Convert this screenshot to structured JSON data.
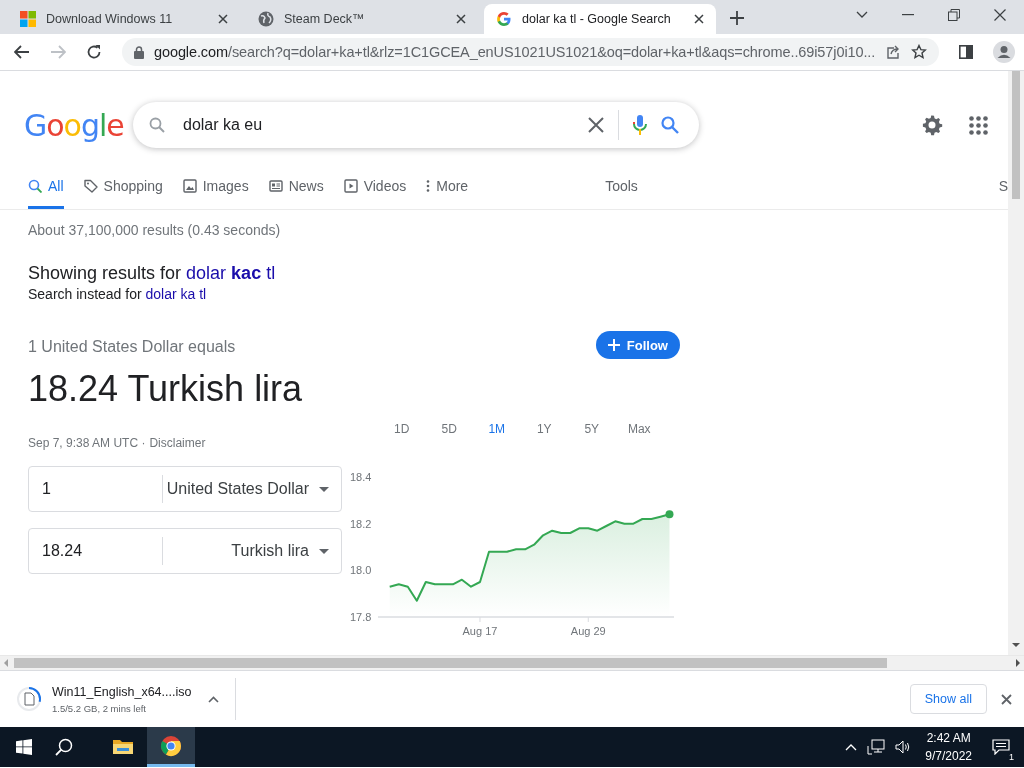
{
  "browser": {
    "tabs": [
      {
        "title": "Download Windows 11",
        "kind": "windows",
        "selected": false
      },
      {
        "title": "Steam Deck™",
        "kind": "globe",
        "selected": false
      },
      {
        "title": "dolar ka tl - Google Search",
        "kind": "google",
        "selected": true
      }
    ],
    "address": "google.com/search?q=dolar+ka+tl&rlz=1C1GCEA_enUS1021US1021&oq=dolar+ka+tl&aqs=chrome..69i57j0i10..."
  },
  "logo": "Google",
  "search": {
    "value": "dolar ka eu"
  },
  "nav_tabs": [
    {
      "label": "All",
      "kind": "search",
      "selected": true
    },
    {
      "label": "Shopping",
      "kind": "tag",
      "selected": false
    },
    {
      "label": "Images",
      "kind": "image",
      "selected": false
    },
    {
      "label": "News",
      "kind": "news",
      "selected": false
    },
    {
      "label": "Videos",
      "kind": "play",
      "selected": false
    },
    {
      "label": "More",
      "kind": "dots",
      "selected": false
    }
  ],
  "tools": "Tools",
  "nav_cut": "S",
  "result_stats": "About 37,100,000 results (0.43 seconds)",
  "spelling": {
    "showing": "Showing results for",
    "corrected": "dolar **kac** tl",
    "instead": "Search instead for",
    "original": "dolar ka tl"
  },
  "converter": {
    "equals": "1 United States Dollar equals",
    "result": "18.24 Turkish lira",
    "follow": "Follow",
    "timestamp": "Sep 7, 9:38 AM UTC ·",
    "disclaimer": "Disclaimer",
    "ranges": [
      {
        "label": "1D",
        "selected": false
      },
      {
        "label": "5D",
        "selected": false
      },
      {
        "label": "1M",
        "selected": true
      },
      {
        "label": "1Y",
        "selected": false
      },
      {
        "label": "5Y",
        "selected": false
      },
      {
        "label": "Max",
        "selected": false
      }
    ],
    "inputs": [
      {
        "value": "1",
        "currency": "United States Dollar"
      },
      {
        "value": "18.24",
        "currency": "Turkish lira"
      }
    ],
    "chart_data": {
      "type": "area",
      "categories": [
        null,
        null,
        null,
        null,
        null,
        null,
        null,
        null,
        null,
        null,
        "Aug 17",
        null,
        null,
        null,
        null,
        null,
        null,
        null,
        null,
        null,
        null,
        null,
        "Aug 29",
        null,
        null,
        null,
        null,
        null,
        null,
        null,
        null,
        null
      ],
      "series": [
        {
          "color": "#34a853",
          "values": [
            17.93,
            17.94,
            17.93,
            17.87,
            17.95,
            17.94,
            17.94,
            17.94,
            17.96,
            17.93,
            17.95,
            18.08,
            18.08,
            18.08,
            18.09,
            18.09,
            18.11,
            18.15,
            18.17,
            18.16,
            18.16,
            18.18,
            18.18,
            18.17,
            18.19,
            18.21,
            18.2,
            18.2,
            18.22,
            18.22,
            18.23,
            18.24
          ]
        }
      ],
      "ylim": [
        17.8,
        18.4
      ],
      "yticks": [
        {
          "value": 17.8,
          "label": "17.8"
        },
        {
          "value": 18,
          "label": "18.0"
        },
        {
          "value": 18.2,
          "label": "18.2"
        },
        {
          "value": 18.4,
          "label": "18.4"
        }
      ]
    }
  },
  "download": {
    "filename": "Win11_English_x64....iso",
    "status": "1.5/5.2 GB, 2 mins left",
    "show_all": "Show all"
  },
  "taskbar": {
    "apps": [
      {
        "kind": "explorer",
        "selected": false
      },
      {
        "kind": "chrome",
        "selected": true
      }
    ],
    "time": "2:42 AM",
    "date": "9/7/2022",
    "notifications": "1"
  }
}
